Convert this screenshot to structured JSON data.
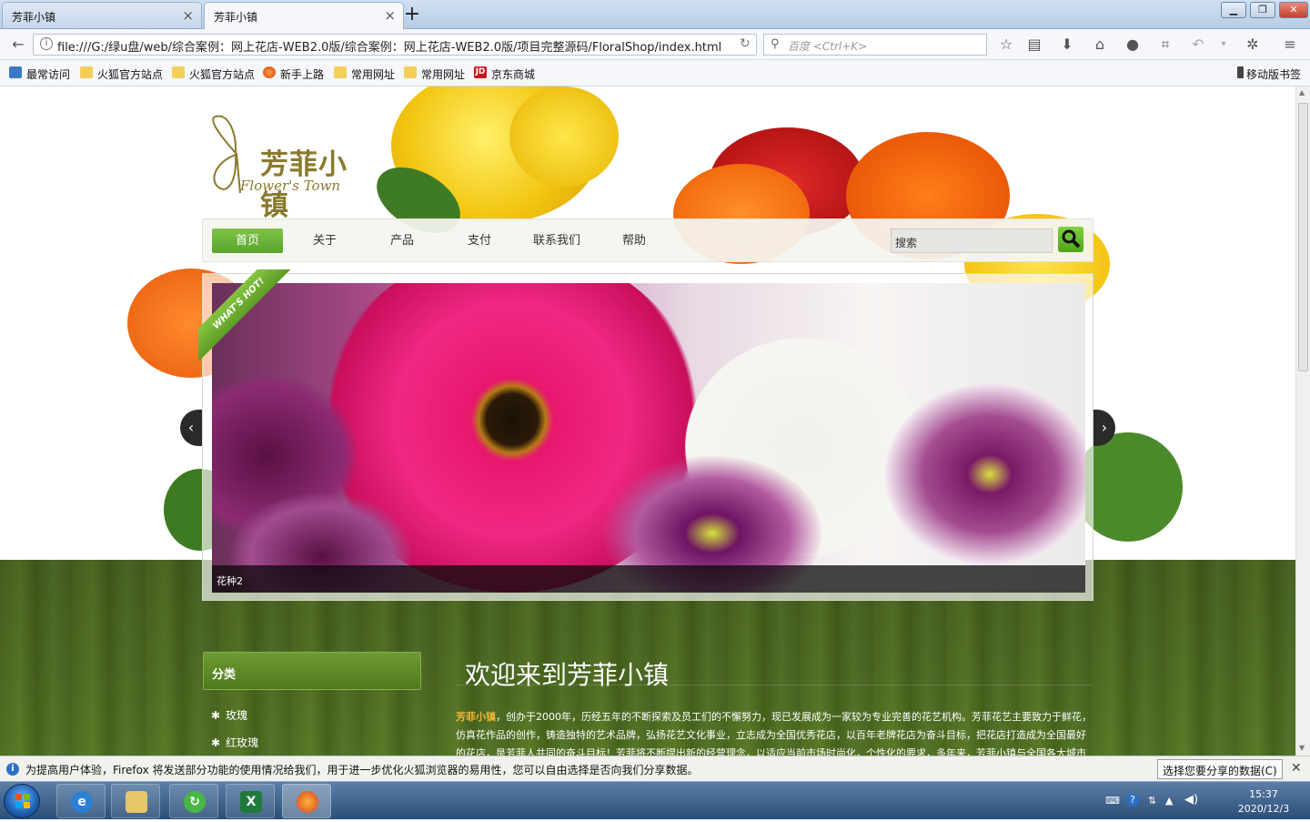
{
  "browser": {
    "tabs": [
      {
        "title": "芳菲小镇",
        "active": false
      },
      {
        "title": "芳菲小镇",
        "active": true
      }
    ],
    "url": "file:///G:/绿u盘/web/综合案例：网上花店-WEB2.0版/综合案例：网上花店-WEB2.0版/项目完整源码/FloralShop/index.html",
    "search_placeholder": "百度 <Ctrl+K>",
    "bookmarks": [
      {
        "label": "最常访问",
        "icon": "most-visited-icon"
      },
      {
        "label": "火狐官方站点",
        "icon": "folder-icon"
      },
      {
        "label": "火狐官方站点",
        "icon": "folder-icon"
      },
      {
        "label": "新手上路",
        "icon": "firefox-icon"
      },
      {
        "label": "常用网址",
        "icon": "folder-icon"
      },
      {
        "label": "常用网址",
        "icon": "folder-icon"
      },
      {
        "label": "京东商城",
        "icon": "jd-icon"
      }
    ],
    "mobile_bookmarks": "移动版书签"
  },
  "site": {
    "logo_cn": "芳菲小镇",
    "logo_en": "Flower's Town",
    "menu": [
      "首页",
      "关于",
      "产品",
      "支付",
      "联系我们",
      "帮助"
    ],
    "search_text": "搜索",
    "ribbon": "WHAT'S HOT!",
    "slide_caption": "花种2",
    "category_title": "分类",
    "categories": [
      "玫瑰",
      "红玫瑰"
    ],
    "welcome": "欢迎来到芳菲小镇",
    "intro_brand": "芳菲小镇",
    "intro_text": "，创办于2000年，历经五年的不断探索及员工们的不懈努力，现已发展成为一家较为专业完善的花艺机构。芳菲花艺主要致力于鲜花，仿真花作品的创作，铸造独特的艺术品牌，弘扬花艺文化事业，立志成为全国优秀花店，以百年老牌花店为奋斗目标，把花店打造成为全国最好的花店，是芳菲人共同的奋斗目标！芳菲将不断提出新的经营理念，以适应当前市场时尚化，个性化的要求，多年来，芳菲小镇与全国各大城市"
  },
  "notification": {
    "text": "为提高用户体验，Firefox 将发送部分功能的使用情况给我们，用于进一步优化火狐浏览器的易用性，您可以自由选择是否向我们分享数据。",
    "button": "选择您要分享的数据(C)"
  },
  "taskbar": {
    "time": "15:37",
    "date": "2020/12/3"
  },
  "colors": {
    "accent_green": "#5aa52b",
    "page_green": "#4f6d22",
    "brand_orange": "#f0b43a"
  }
}
